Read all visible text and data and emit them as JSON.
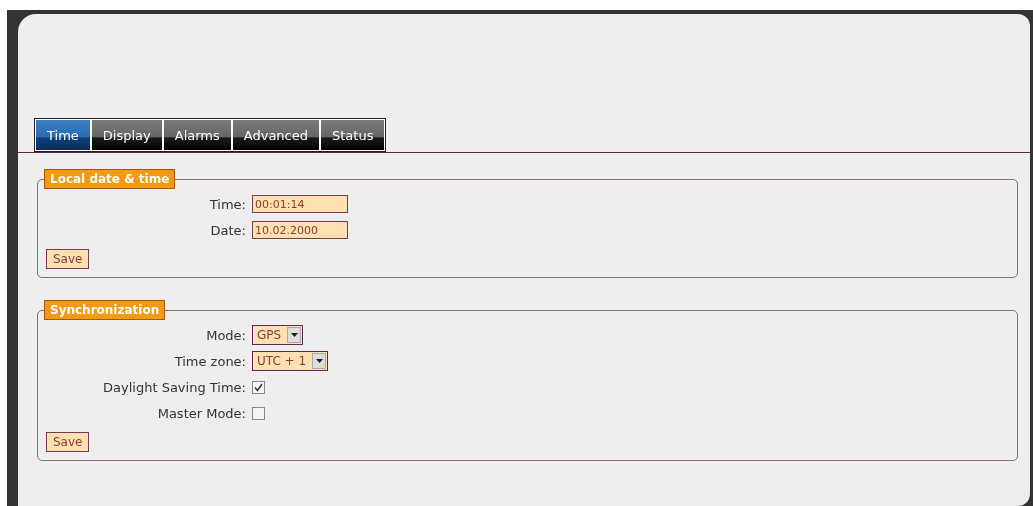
{
  "tabs": [
    {
      "label": "Time",
      "selected": true
    },
    {
      "label": "Display",
      "selected": false
    },
    {
      "label": "Alarms",
      "selected": false
    },
    {
      "label": "Advanced",
      "selected": false
    },
    {
      "label": "Status",
      "selected": false
    }
  ],
  "sections": [
    {
      "legend": "Local date & time",
      "fields": [
        {
          "kind": "text",
          "label": "Time:",
          "value": "00:01:14"
        },
        {
          "kind": "text",
          "label": "Date:",
          "value": "10.02.2000"
        }
      ],
      "save_button": "Save"
    },
    {
      "legend": "Synchronization",
      "fields": [
        {
          "kind": "select",
          "label": "Mode:",
          "value": "GPS"
        },
        {
          "kind": "select",
          "label": "Time zone:",
          "value": "UTC + 1"
        },
        {
          "kind": "checkbox",
          "label": "Daylight Saving Time:",
          "checked": true
        },
        {
          "kind": "checkbox",
          "label": "Master Mode:",
          "checked": false
        }
      ],
      "save_button": "Save"
    }
  ]
}
